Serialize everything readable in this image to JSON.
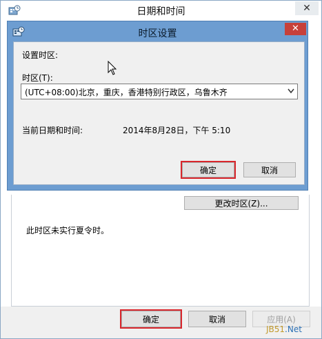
{
  "outer_window": {
    "title": "日期和时间",
    "close_symbol": "✕",
    "change_timezone_label": "更改时区(Z)...",
    "dst_message": "此时区未实行夏令时。",
    "ok_label": "确定",
    "cancel_label": "取消",
    "apply_label": "应用(A)",
    "icon": "datetime-settings-icon"
  },
  "dialog": {
    "title": "时区设置",
    "close_symbol": "✕",
    "icon": "datetime-settings-icon",
    "section_label": "设置时区:",
    "timezone_label": "时区(T):",
    "timezone_value": "(UTC+08:00)北京，重庆，香港特别行政区，乌鲁木齐",
    "current_datetime_label": "当前日期和时间:",
    "current_datetime_value": "2014年8月28日，下午 5:10",
    "ok_label": "确定",
    "cancel_label": "取消"
  },
  "watermark": {
    "left": "JB51",
    "right": ".Net"
  },
  "colors": {
    "highlight": "#d9262c",
    "dialog_frame": "#6d9dd1",
    "close_red": "#c7403a"
  }
}
